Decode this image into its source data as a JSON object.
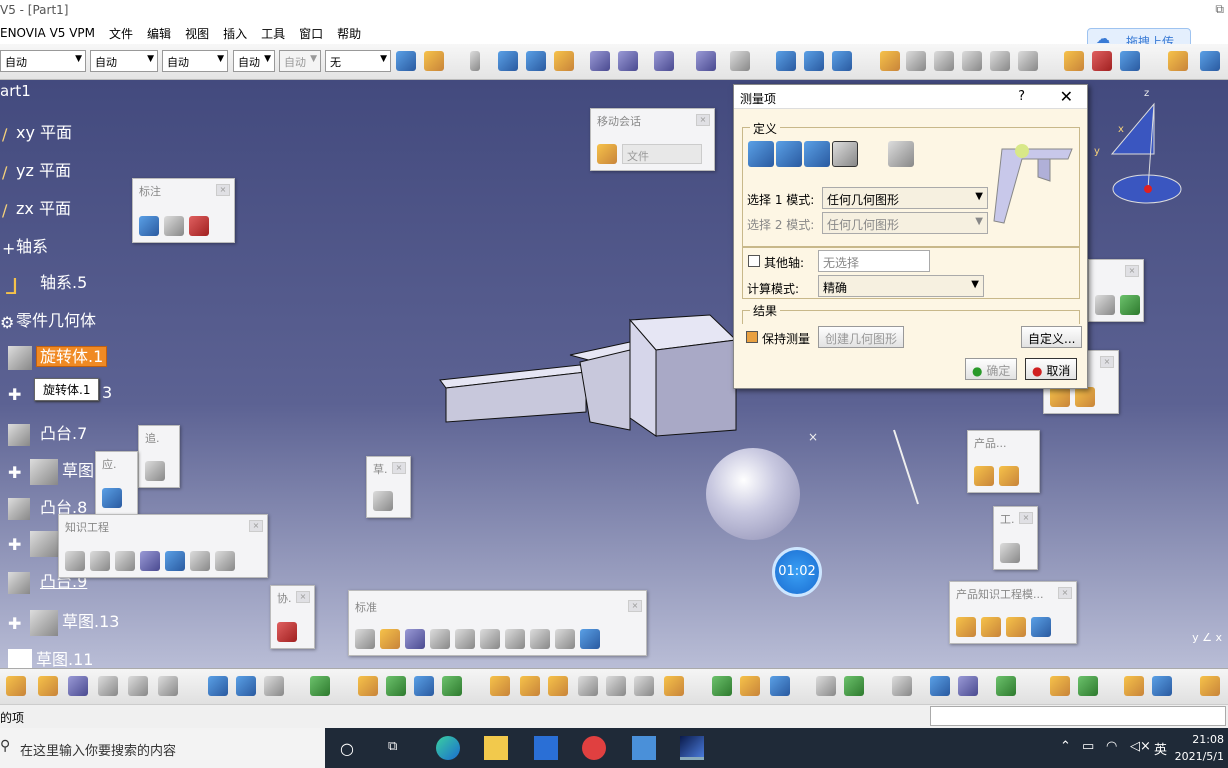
{
  "window": {
    "title": "V5 - [Part1]"
  },
  "menu": [
    "ENOVIA V5 VPM",
    "文件",
    "编辑",
    "视图",
    "插入",
    "工具",
    "窗口",
    "帮助"
  ],
  "toolbar": {
    "combos": [
      "自动",
      "自动",
      "自动",
      "自动",
      "自动",
      "无"
    ]
  },
  "upload_button": "拖拽上传",
  "tree": {
    "root": "art1",
    "items": [
      "xy 平面",
      "yz 平面",
      "zx 平面",
      "轴系",
      "轴系.5",
      "零件几何体",
      "旋转体.1",
      "3",
      "凸台.7",
      "草图",
      "凸台.8",
      "凸台.9",
      "草图.13",
      "草图.11"
    ],
    "tooltip": "旋转体.1"
  },
  "floating_toolbars": {
    "annotation": "标注",
    "move_session": "移动会话",
    "move_session_combo": "文件",
    "trace": "追.",
    "apply": "应.",
    "sketch": "草.",
    "knowledge": "知识工程",
    "collab": "协.",
    "standard": "标准",
    "product": "产品...",
    "tool": "工.",
    "product_knowledge": "产品知识工程模..."
  },
  "dialog": {
    "title": "测量项",
    "help": "?",
    "definition_group": "定义",
    "sel1_label": "选择 1 模式:",
    "sel1_value": "任何几何图形",
    "sel2_label": "选择 2 模式:",
    "sel2_value": "任何几何图形",
    "other_axis_label": "其他轴:",
    "other_axis_value": "无选择",
    "calc_label": "计算模式:",
    "calc_value": "精确",
    "result_group": "结果",
    "keep_measure": "保持测量",
    "create_geometry": "创建几何图形",
    "customize": "自定义...",
    "ok": "确定",
    "cancel": "取消"
  },
  "timer": "01:02",
  "status": {
    "text": "的项"
  },
  "taskbar": {
    "search_placeholder": "在这里输入你要搜索的内容",
    "time": "21:08",
    "date": "2021/5/1",
    "ime": "英"
  },
  "colors": {
    "viewport_top": "#434a7e",
    "viewport_bottom": "#b9bdd6",
    "selection": "#f08a24",
    "dialog_bg": "#fdf6e4"
  }
}
